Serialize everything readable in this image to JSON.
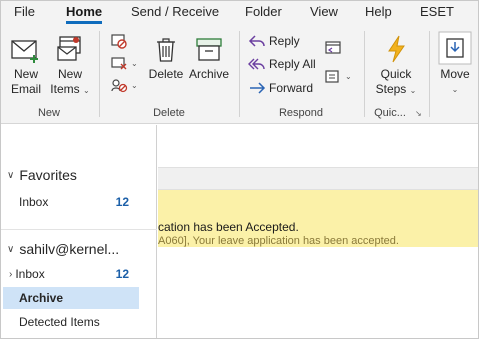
{
  "menu": {
    "tabs": [
      "File",
      "Home",
      "Send / Receive",
      "Folder",
      "View",
      "Help",
      "ESET"
    ],
    "active": "Home"
  },
  "ribbon": {
    "new_group": {
      "label": "New",
      "new_email": [
        "New",
        "Email"
      ],
      "new_items": [
        "New",
        "Items"
      ]
    },
    "delete_group": {
      "label": "Delete",
      "delete": "Delete",
      "archive": "Archive"
    },
    "respond_group": {
      "label": "Respond",
      "reply": "Reply",
      "reply_all": "Reply All",
      "forward": "Forward"
    },
    "quick_steps_group": {
      "label": "Quic...",
      "button": [
        "Quick",
        "Steps"
      ]
    },
    "move_group": {
      "move": "Move"
    }
  },
  "folder_pane": {
    "favorites": {
      "header": "Favorites",
      "items": [
        {
          "label": "Inbox",
          "count": "12"
        }
      ]
    },
    "account": {
      "header": "sahilv@kernel...",
      "items": [
        {
          "label": "Inbox",
          "count": "12",
          "expandable": true
        },
        {
          "label": "Archive",
          "count": "",
          "selected": true
        },
        {
          "label": "Detected Items",
          "count": ""
        }
      ]
    }
  },
  "message_list": {
    "rows": [
      {
        "subject": "cation has been Accepted.",
        "preview": "A060],  Your leave application has been accepted.",
        "highlight_color": "#fbf1a8"
      }
    ]
  },
  "colors": {
    "accent": "#0f6cbd",
    "selected_folder": "#cfe3f7",
    "unread_count": "#1b5fa8",
    "message_highlight": "#fbf1a8"
  }
}
